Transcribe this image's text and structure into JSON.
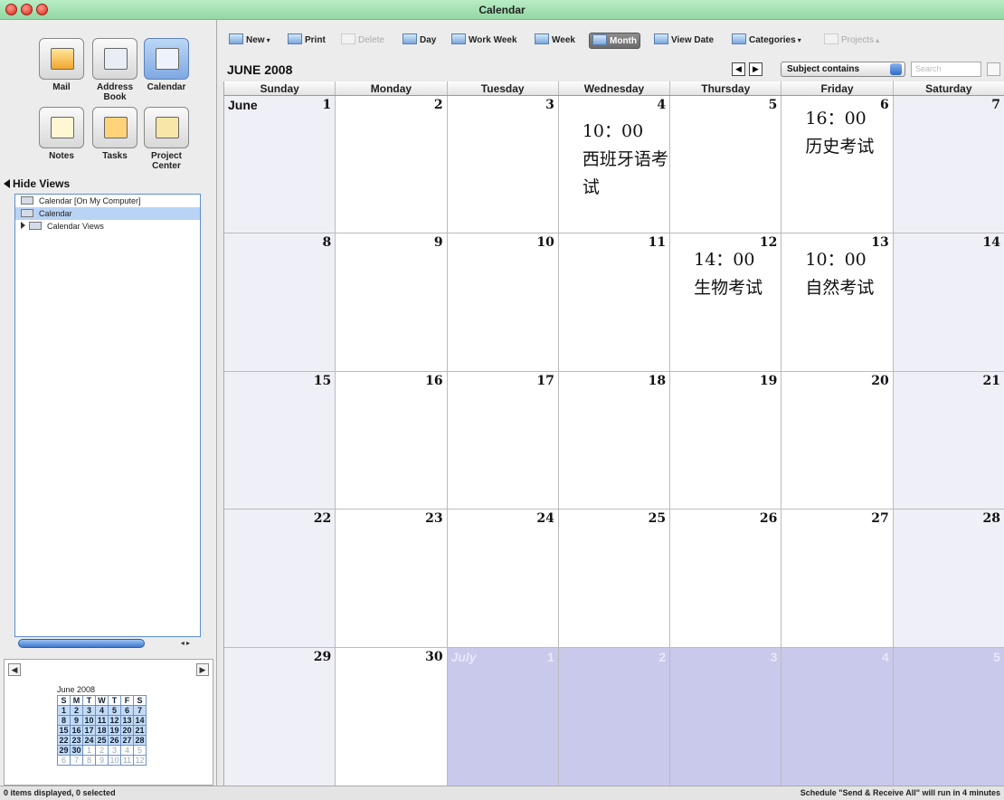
{
  "window": {
    "title": "Calendar"
  },
  "apps": [
    {
      "label": "Mail"
    },
    {
      "label": "Address Book"
    },
    {
      "label": "Calendar"
    },
    {
      "label": "Notes"
    },
    {
      "label": "Tasks"
    },
    {
      "label": "Project Center"
    }
  ],
  "sidebar": {
    "hide_views": "Hide Views",
    "views": [
      {
        "label": "Calendar [On My Computer]"
      },
      {
        "label": "Calendar"
      },
      {
        "label": "Calendar Views"
      }
    ]
  },
  "minical": {
    "month": "June 2008",
    "days_header": [
      "S",
      "M",
      "T",
      "W",
      "T",
      "F",
      "S"
    ],
    "rows": [
      [
        "1",
        "2",
        "3",
        "4",
        "5",
        "6",
        "7"
      ],
      [
        "8",
        "9",
        "10",
        "11",
        "12",
        "13",
        "14"
      ],
      [
        "15",
        "16",
        "17",
        "18",
        "19",
        "20",
        "21"
      ],
      [
        "22",
        "23",
        "24",
        "25",
        "26",
        "27",
        "28"
      ],
      [
        "29",
        "30",
        "1",
        "2",
        "3",
        "4",
        "5"
      ],
      [
        "6",
        "7",
        "8",
        "9",
        "10",
        "11",
        "12"
      ]
    ]
  },
  "toolbar": {
    "new": "New",
    "print": "Print",
    "delete": "Delete",
    "day": "Day",
    "work_week": "Work Week",
    "week": "Week",
    "month": "Month",
    "view_date": "View Date",
    "categories": "Categories",
    "projects": "Projects"
  },
  "header": {
    "month_title": "JUNE 2008",
    "filter": "Subject contains",
    "search_placeholder": "Search"
  },
  "calendar": {
    "day_names": [
      "Sunday",
      "Monday",
      "Tuesday",
      "Wednesday",
      "Thursday",
      "Friday",
      "Saturday"
    ],
    "month_label": "June",
    "next_month_label": "July",
    "weeks": [
      [
        "1",
        "2",
        "3",
        "4",
        "5",
        "6",
        "7"
      ],
      [
        "8",
        "9",
        "10",
        "11",
        "12",
        "13",
        "14"
      ],
      [
        "15",
        "16",
        "17",
        "18",
        "19",
        "20",
        "21"
      ],
      [
        "22",
        "23",
        "24",
        "25",
        "26",
        "27",
        "28"
      ],
      [
        "29",
        "30",
        "1",
        "2",
        "3",
        "4",
        "5"
      ]
    ],
    "events": {
      "wed4": {
        "time": "10：00",
        "text": "西班牙语考试"
      },
      "fri6": {
        "time": "16：00",
        "text": "历史考试"
      },
      "thu12": {
        "time": "14：00",
        "text": "生物考试"
      },
      "fri13": {
        "time": "10：00",
        "text": "自然考试"
      }
    }
  },
  "status": {
    "left": "0 items displayed, 0 selected",
    "right": "Schedule \"Send & Receive All\" will run in 4 minutes"
  }
}
